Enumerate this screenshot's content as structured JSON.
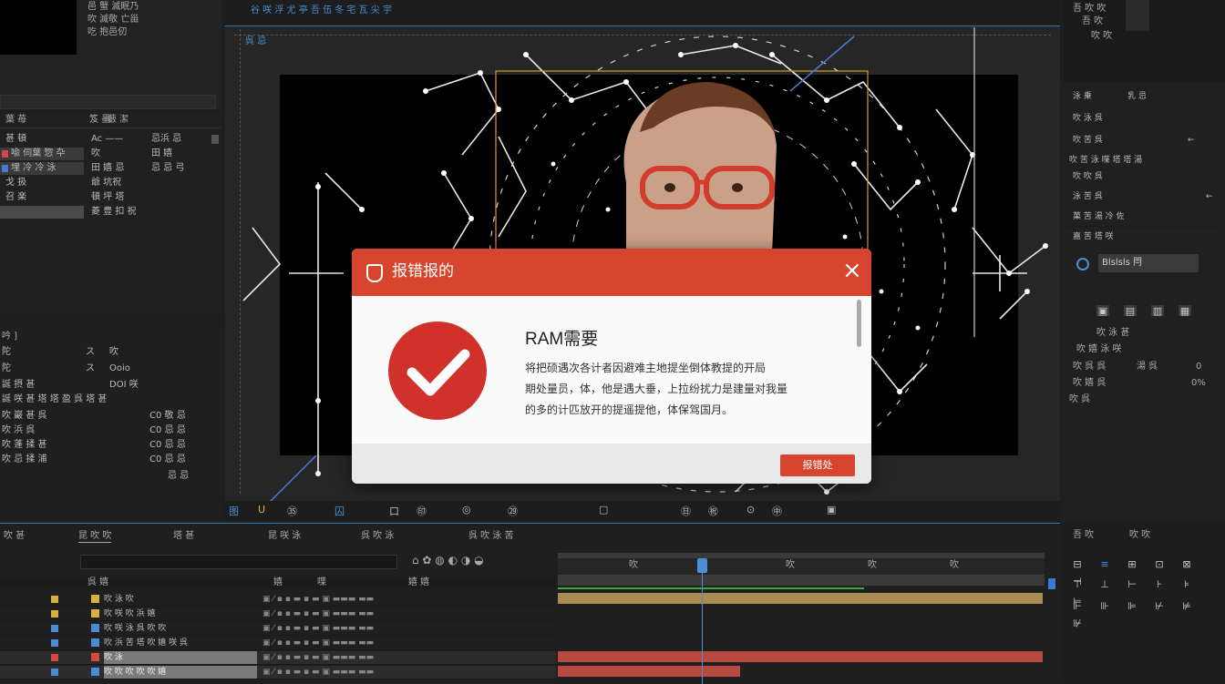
{
  "project_panel": {
    "info_lines": [
      "邑 蟹 滅眠乃",
      "吹 滅敬 亡甾",
      "吃 抱邑仞"
    ],
    "search_placeholder": "",
    "col_headers": [
      "葉 苺",
      "笈 墨",
      "藪 潔"
    ],
    "items": [
      {
        "name": "甚 頓",
        "a": "Ac ——",
        "b": "忌浜 忌"
      },
      {
        "name": "喩 伺葉 惣 卆",
        "a": "吹",
        "b": "田 嬉"
      },
      {
        "name": "埋 冷 冷 泳",
        "a": "田 嬉 忌",
        "b": "忌 忌 弓"
      },
      {
        "name": "戈 扱",
        "a": "爺 坑祝",
        "b": ""
      },
      {
        "name": "召 楽",
        "a": "頓 坪 塔",
        "b": ""
      },
      {
        "name": "",
        "a": "菱 豊 扣 祝",
        "b": ""
      }
    ]
  },
  "effects_panel": {
    "title": "吟 ]",
    "rows": [
      {
        "name": "陀",
        "a": "ス",
        "b": "吹"
      },
      {
        "name": "陀",
        "a": "ス",
        "b": "Ooio"
      },
      {
        "name": "誕 摂 甚",
        "a": "",
        "b": "DOI 咲"
      },
      {
        "name": "誕 咲 甚 塔 塔 盈 呉 塔 甚",
        "a": "",
        "b": ""
      },
      {
        "name": "吹 巖 甚 呉",
        "a": "",
        "b": "C0 敬 忌"
      },
      {
        "name": "吹 浜 呉",
        "a": "",
        "b": "C0 忌 忌"
      },
      {
        "name": "吹 蓬 揉 甚",
        "a": "",
        "b": "C0 忌 忌"
      },
      {
        "name": "吹 忌 揉 浦",
        "a": "",
        "b": "C0 忌 忌"
      },
      {
        "name": "",
        "a": "",
        "b": "忌 忌"
      }
    ]
  },
  "comp_header": {
    "tabs_text": "谷 咲 浮 尤 亭 吾 伍 冬 宅 瓦 尖 宇",
    "label": "呉 忌"
  },
  "viewer_toolbar": [
    "图",
    "U",
    "㉟",
    "囚",
    "口",
    "㊞",
    "◎",
    "㉙",
    "▢",
    "㊐",
    "㊗",
    "⊙",
    "㊥",
    "▣"
  ],
  "right_panel": {
    "header": [
      "吾 吹 吹",
      "吾 吹",
      "吹 吹"
    ],
    "rows": [
      {
        "label": "泳 乗",
        "value": "乳 忌"
      },
      {
        "label": "吹 泳 呉",
        "value": ""
      },
      {
        "label": "吹 苦 呉",
        "value": "←"
      },
      {
        "label": "吹 苦 泳 喋 塔 塔 湯",
        "value": ""
      },
      {
        "label": "吹 吹 呉",
        "value": ""
      },
      {
        "label": "泳 苦 呉",
        "value": "←"
      },
      {
        "label": "菓 苦 湯 冷 佐",
        "value": ""
      },
      {
        "label": "嘉 苦 塔 咲",
        "value": ""
      }
    ],
    "select_label": "Blslsls 閂",
    "props": [
      {
        "a": "吹 泳 甚",
        "b": "",
        "c": ""
      },
      {
        "a": "吹 嬉 泳 咲",
        "b": "",
        "c": ""
      },
      {
        "a": "吹 呉 呉",
        "b": "湯 呉",
        "c": "0"
      },
      {
        "a": "吹 嬉 呉",
        "b": "",
        "c": "0%"
      },
      {
        "a": "吹 呉",
        "b": "",
        "c": ""
      }
    ]
  },
  "timeline": {
    "tabs": [
      "吹 甚",
      "昆 吹 吹",
      "塔 甚",
      "昆 咲 泳",
      "呉 吹 泳",
      "呉 吹 泳 苦"
    ],
    "search_placeholder": "",
    "col_headers": [
      "呉 嬉",
      "",
      "嬉",
      "喋",
      "嬉 嬉"
    ],
    "layers": [
      {
        "name": "吹 泳 吹",
        "color": "#d8b23a"
      },
      {
        "name": "吹 咲 吹 浜 嬉",
        "color": "#d8b23a"
      },
      {
        "name": "吹 咲 泳 呉 吹 吹",
        "color": "#4a8bd8"
      },
      {
        "name": "吹 浜 苦 塔 吹 嬉 咲 呉",
        "color": "#4a8bd8"
      },
      {
        "name": "吹 泳",
        "color": "#d44a3e"
      },
      {
        "name": "吹 吹 吹 吹 吹 嬉",
        "color": "#4a8bd8"
      }
    ],
    "ruler": [
      "吹",
      "吹",
      "吹",
      "吹",
      "吹"
    ],
    "playhead": 0.21
  },
  "right_bottom": {
    "header": [
      "吾 吹",
      "吹 吹"
    ]
  },
  "dialog": {
    "title": "报错报的",
    "close": "×",
    "heading": "RAM需要",
    "body": [
      "将把硕遇次各计者因避难主地提坐倒体教提的开局",
      "期处量员，体，他是遇大垂，上拉纷扰力是建量对我量",
      "的多的计匹放开的提遥提他，体保驾国月。"
    ],
    "ok_label": "报错处",
    "accent": "#d8452e"
  }
}
